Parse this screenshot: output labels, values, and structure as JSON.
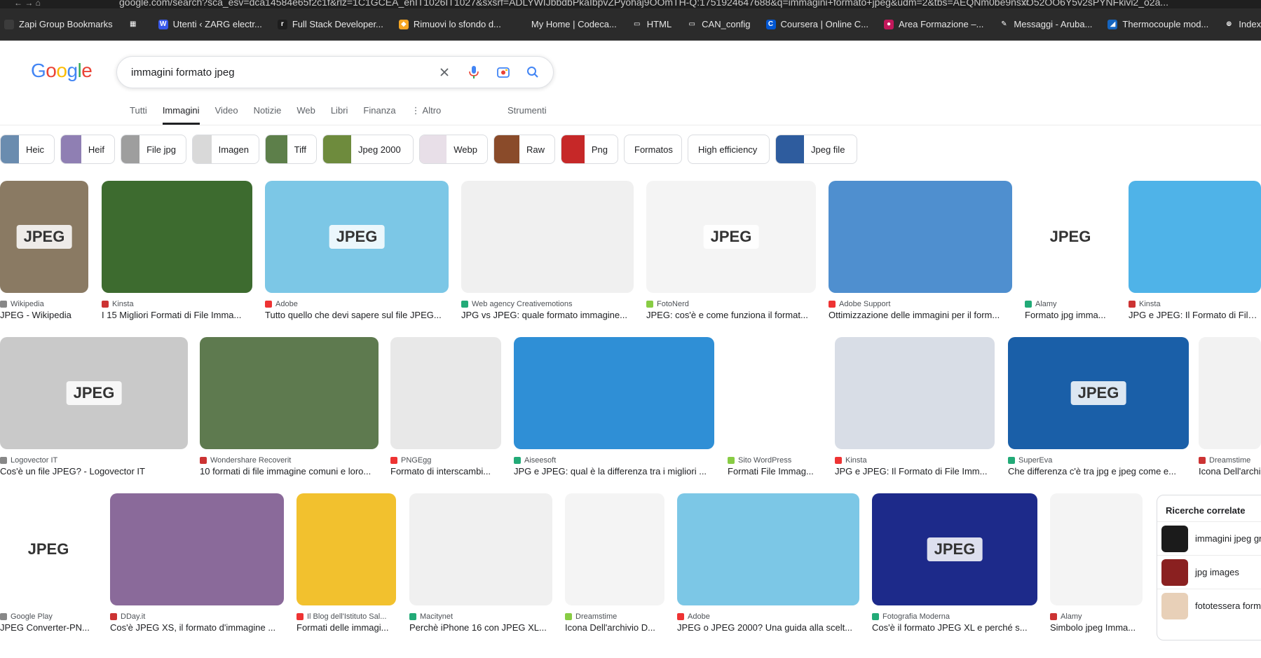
{
  "browser": {
    "url": "google.com/search?sca_esv=dca14584e65f2c1f&rlz=1C1GCEA_enIT1026IT1027&sxsrf=ADLYWIJbbdbPkaIbpvZPyohaj9OOmTH-Q:1751924647688&q=immagini+formato+jpeg&udm=2&tbs=AEQNm0be9nsxO52OO6Y5v2sPYNFkivi2_o2a...",
    "bookmarks": [
      {
        "label": "Zapi Group Bookmarks",
        "color": "#3c3c3c",
        "glyph": ""
      },
      {
        "label": "",
        "color": "#2b2b2b",
        "glyph": "▦"
      },
      {
        "label": "Utenti ‹ ZARG electr...",
        "color": "#3858e9",
        "glyph": "W"
      },
      {
        "label": "Full Stack Developer...",
        "color": "#1d1d1d",
        "glyph": "r"
      },
      {
        "label": "Rimuovi lo sfondo d...",
        "color": "#f5a623",
        "glyph": "◆"
      },
      {
        "label": "My Home | Codeca...",
        "color": "#2b2b2b",
        "glyph": ""
      },
      {
        "label": "HTML",
        "color": "#2b2b2b",
        "glyph": "▭"
      },
      {
        "label": "CAN_config",
        "color": "#2b2b2b",
        "glyph": "▭"
      },
      {
        "label": "Coursera | Online C...",
        "color": "#0056d2",
        "glyph": "C"
      },
      {
        "label": "Area Formazione –...",
        "color": "#c2185b",
        "glyph": "●"
      },
      {
        "label": "Messaggi - Aruba...",
        "color": "#2b2b2b",
        "glyph": "✎"
      },
      {
        "label": "Thermocouple mod...",
        "color": "#1565c0",
        "glyph": "◢"
      },
      {
        "label": "Index of /",
        "color": "#2b2b2b",
        "glyph": "⊕"
      }
    ]
  },
  "search": {
    "query": "immagini formato jpeg"
  },
  "tabs": [
    "Tutti",
    "Immagini",
    "Video",
    "Notizie",
    "Web",
    "Libri",
    "Finanza",
    "⋮ Altro"
  ],
  "active_tab": "Immagini",
  "tools_label": "Strumenti",
  "chips": [
    {
      "label": "Heic",
      "thumb": "#6a8caf",
      "w": 78
    },
    {
      "label": "Heif",
      "thumb": "#8f7fb3",
      "w": 78
    },
    {
      "label": "File jpg",
      "thumb": "#9e9e9e",
      "w": 94
    },
    {
      "label": "Imagen",
      "thumb": "#d9d9d9",
      "w": 96
    },
    {
      "label": "Tiff",
      "thumb": "#5d7f4a",
      "w": 74
    },
    {
      "label": "Jpeg 2000",
      "thumb": "#6e8b3d",
      "w": 130
    },
    {
      "label": "Webp",
      "thumb": "#e8dfe8",
      "w": 98
    },
    {
      "label": "Raw",
      "thumb": "#8a4b2a",
      "w": 88
    },
    {
      "label": "Png",
      "thumb": "#c62828",
      "w": 82
    },
    {
      "label": "Formatos",
      "thumb": "",
      "w": 83
    },
    {
      "label": "High efficiency",
      "thumb": "",
      "w": 117
    },
    {
      "label": "Jpeg file",
      "thumb": "#2e5c9e",
      "w": 117
    }
  ],
  "results": [
    {
      "source": "Wikipedia",
      "caption": "JPEG - Wikipedia",
      "color": "#8a7a63"
    },
    {
      "source": "Kinsta",
      "caption": "I 15 Migliori Formati di File Imma...",
      "color": "#3d6b2f"
    },
    {
      "source": "Adobe",
      "caption": "Tutto quello che devi sapere sul file JPEG...",
      "color": "#7cc7e6"
    },
    {
      "source": "Web agency Creativemotions",
      "caption": "JPG vs JPEG: quale formato immagine...",
      "color": "#f0f0f0"
    },
    {
      "source": "FotoNerd",
      "caption": "JPEG: cos'è e come funziona il format...",
      "color": "#f4f4f4"
    },
    {
      "source": "Adobe Support",
      "caption": "Ottimizzazione delle immagini per il form...",
      "color": "#4f8fcf"
    },
    {
      "source": "Alamy",
      "caption": "Formato jpg imma...",
      "color": "#ffffff"
    },
    {
      "source": "Kinsta",
      "caption": "JPG e JPEG: Il Formato di File In",
      "color": "#4fb3e8"
    },
    {
      "source": "Logovector IT",
      "caption": "Cos'è un file JPEG? - Logovector IT",
      "color": "#c9c9c9"
    },
    {
      "source": "Wondershare Recoverit",
      "caption": "10 formati di file immagine comuni e loro...",
      "color": "#5e7a4f"
    },
    {
      "source": "PNGEgg",
      "caption": "Formato di interscambi...",
      "color": "#e8e8e8"
    },
    {
      "source": "Aiseesoft",
      "caption": "JPG e JPEG: qual è la differenza tra i migliori ...",
      "color": "#2f8fd6"
    },
    {
      "source": "Sito WordPress",
      "caption": "Formati File Immag...",
      "color": "#ffffff"
    },
    {
      "source": "Kinsta",
      "caption": "JPG e JPEG: Il Formato di File Imm...",
      "color": "#d8dde6"
    },
    {
      "source": "SuperEva",
      "caption": "Che differenza c'è tra jpg e jpeg come e...",
      "color": "#1a5fa8"
    },
    {
      "source": "Dreamstime",
      "caption": "Icona Dell'archi",
      "color": "#f2f2f2"
    },
    {
      "source": "Google Play",
      "caption": "JPEG Converter-PN...",
      "color": "#ffffff"
    },
    {
      "source": "DDay.it",
      "caption": "Cos'è JPEG XS, il formato d'immagine ...",
      "color": "#8a6a9a"
    },
    {
      "source": "Il Blog dell'Istituto Sal...",
      "caption": "Formati delle immagi...",
      "color": "#f2c12e"
    },
    {
      "source": "Macitynet",
      "caption": "Perchè iPhone 16 con JPEG XL...",
      "color": "#f0f0f0"
    },
    {
      "source": "Dreamstime",
      "caption": "Icona Dell'archivio D...",
      "color": "#f4f4f4"
    },
    {
      "source": "Adobe",
      "caption": "JPEG o JPEG 2000? Una guida alla scelt...",
      "color": "#7cc7e6"
    },
    {
      "source": "Fotografia Moderna",
      "caption": "Cos'è il formato JPEG XL e perché s...",
      "color": "#1d2a8a"
    },
    {
      "source": "Alamy",
      "caption": "Simbolo jpeg Imma...",
      "color": "#f4f4f4"
    }
  ],
  "related": {
    "title": "Ricerche correlate",
    "items": [
      {
        "label": "immagini jpeg gr",
        "color": "#1b1b1b"
      },
      {
        "label": "jpg images",
        "color": "#8a2020"
      },
      {
        "label": "fototessera form",
        "color": "#e8d0b8"
      }
    ]
  },
  "colors": {
    "blue": "#4285F4",
    "red": "#EA4335",
    "yellow": "#FBBC05",
    "green": "#34A853"
  }
}
